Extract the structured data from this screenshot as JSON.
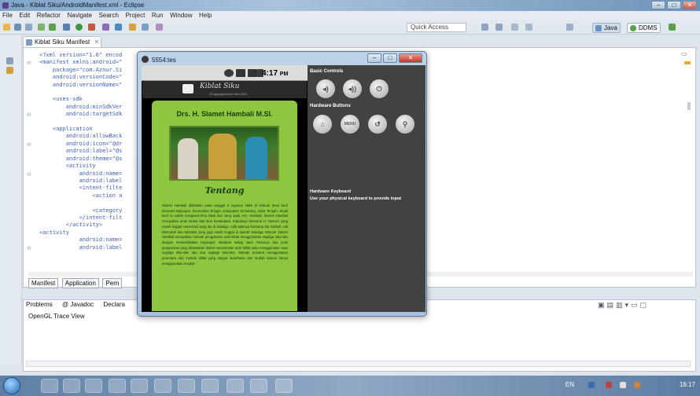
{
  "window": {
    "title": "Java - Kiblat Siku/AndroidManifest.xml - Eclipse"
  },
  "menu": [
    "File",
    "Edit",
    "Refactor",
    "Navigate",
    "Search",
    "Project",
    "Run",
    "Window",
    "Help"
  ],
  "toolbar": {
    "quick_access": "Quick Access",
    "perspectives": [
      {
        "label": "Java",
        "active": true
      },
      {
        "label": "DDMS",
        "active": false
      }
    ]
  },
  "editor": {
    "tab_label": "Kiblat Siku Manifest",
    "code_lines": [
      "<?xml version=\"1.0\" encod",
      "<manifest xmlns:android=\"",
      "    package=\"com.Aznur.Si",
      "    android:versionCode=\"",
      "    android:versionName=\"",
      "",
      "    <uses-sdk",
      "        android:minSdkVer",
      "        android:targetSdk",
      "",
      "    <application",
      "        android:allowBack",
      "        android:icon=\"@dr",
      "        android:label=\"@s",
      "        android:theme=\"@s",
      "        <activity",
      "            android:name=",
      "            android:label",
      "            <intent-filte",
      "                <action a",
      "",
      "                <category",
      "            </intent-filt",
      "        </activity>",
      "<activity",
      "            android:name=",
      "            android:label"
    ],
    "bottom_tabs": [
      "Manifest",
      "Application",
      "Pern"
    ]
  },
  "bottom_view": {
    "tabs": [
      "Problems",
      "@ Javadoc",
      "Declara"
    ],
    "content": "OpenGL Trace View"
  },
  "emulator": {
    "title": "5554:tes",
    "clock": "4:17",
    "clock_suffix": "PM",
    "app": {
      "logo_text": "Kiblat Siku",
      "logo_sub": "©Copyright Dwik Yani 2021",
      "name": "Drs. H. Slamet Hambali M.SI.",
      "heading": "Tentang",
      "body": "Slamet Hambali dilahirkan pada tanggal 5 Agustus 1954 di sebuah desa kecil bernama Bajangan, Kecamatan Bringin, Kabupaten Semarang, Jawa Tengah. Sejak kecil ia sudah mengenal ilmu falak dari sang ayah, KH. Hambali. Slamet Hambali merupakan anak kedua dari lima bersaudara. Kakaknya bernama H. Ma'rum yang masih tinggal menemani sang ibu di Salatiga. Adik-adiknya bernama Siti Fatihah, Siti Mas'udah dan Muhasin yang juga masih tinggal di daerah Salatiga. Metode Slamet Hambali merupakan metode pengukuran arah kiblat menggunakan segitiga siku-siku dengan memanfaatkan bayangan Matahari setiap saat. Tentunya dua jenis pengukuran yang ditawarkan dalam menentukan arah kiblat yaitu menggunakan satu segitiga siku-siku dan dua segitiga siku-siku. Metode tersebut menggunakan perantara dari metode kiblat yang sangat sederhana dan mudah karena hanya menggunakan tongkat"
    },
    "controls": {
      "basic_title": "Basic Controls",
      "hardware_title": "Hardware Buttons",
      "menu_label": "MENU",
      "keyboard_title": "Hardware Keyboard",
      "keyboard_text": "Use your physical keyboard to provide input"
    }
  },
  "taskbar": {
    "language": "EN",
    "time": "16:17"
  },
  "colors": {
    "accent_green": "#8dc63f",
    "controls_bg": "#424242",
    "code_blue": "#3f5fbf"
  }
}
